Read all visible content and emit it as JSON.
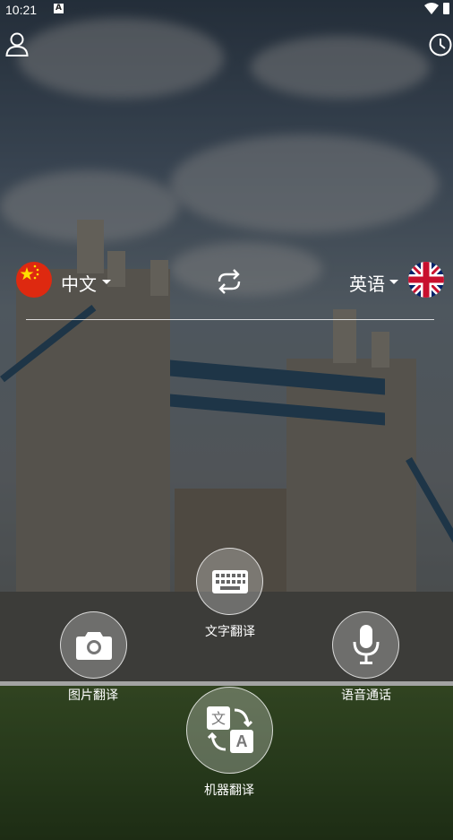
{
  "status_bar": {
    "time": "10:21",
    "notification_badge": "A"
  },
  "header": {
    "profile_icon": "person-icon",
    "history_icon": "clock-history-icon"
  },
  "languages": {
    "source": {
      "label": "中文",
      "flag": "china-flag"
    },
    "target": {
      "label": "英语",
      "flag": "uk-flag"
    },
    "swap_icon": "swap-icon"
  },
  "actions": {
    "text_translation": {
      "label": "文字翻译",
      "icon": "keyboard-icon"
    },
    "image_translation": {
      "label": "图片翻译",
      "icon": "camera-icon"
    },
    "voice_call": {
      "label": "语音通话",
      "icon": "microphone-icon"
    },
    "machine_translation": {
      "label": "机器翻译",
      "icon": "translate-icon"
    }
  },
  "colors": {
    "china_red": "#de2910",
    "china_yellow": "#ffde00",
    "uk_blue": "#012169",
    "uk_red": "#c8102e"
  }
}
